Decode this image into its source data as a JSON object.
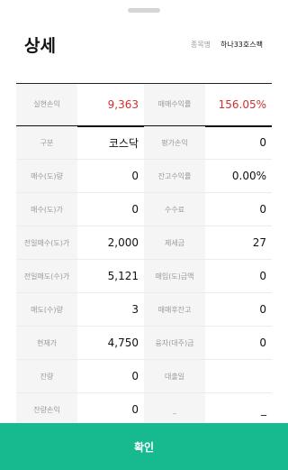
{
  "header": {
    "title": "상세",
    "stock_label": "종목명",
    "stock_name": "하나33호스팩"
  },
  "summary": {
    "realized_label": "실현손익",
    "realized_value": "9,363",
    "return_label": "매매수익률",
    "return_value": "156.05%"
  },
  "rows": [
    {
      "l1": "구분",
      "v1": "코스닥",
      "l2": "평가손익",
      "v2": "0"
    },
    {
      "l1": "매수(도)량",
      "v1": "0",
      "l2": "잔고수익률",
      "v2": "0.00%"
    },
    {
      "l1": "매수(도)가",
      "v1": "0",
      "l2": "수수료",
      "v2": "0"
    },
    {
      "l1": "전일매수(도)가",
      "v1": "2,000",
      "l2": "제세금",
      "v2": "27"
    },
    {
      "l1": "전일매도(수)가",
      "v1": "5,121",
      "l2": "매입(도)금액",
      "v2": "0"
    },
    {
      "l1": "매도(수)량",
      "v1": "3",
      "l2": "매매후잔고",
      "v2": "0"
    },
    {
      "l1": "현재가",
      "v1": "4,750",
      "l2": "융자(대주)금",
      "v2": "0"
    },
    {
      "l1": "잔량",
      "v1": "0",
      "l2": "대출일",
      "v2": ""
    },
    {
      "l1": "잔량손익",
      "v1": "0",
      "l2": "_",
      "v2": "_"
    }
  ],
  "footer": {
    "confirm_label": "확인"
  },
  "colors": {
    "accent": "#17b98f",
    "negative": "#d0312d"
  }
}
